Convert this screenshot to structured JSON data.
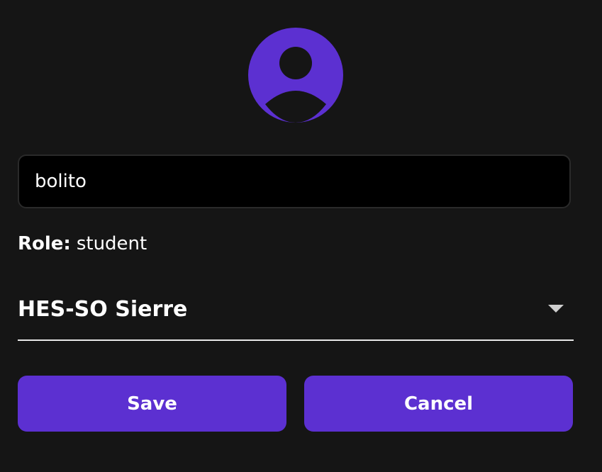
{
  "avatar": {
    "icon": "user-avatar-icon",
    "color": "#5c30d1"
  },
  "profile_form": {
    "username_value": "bolito",
    "role_label": "Role:",
    "role_value": "student",
    "school_select": {
      "selected": "HES-SO Sierre",
      "icon": "dropdown-arrow-icon"
    },
    "save_label": "Save",
    "cancel_label": "Cancel"
  },
  "colors": {
    "background": "#151515",
    "accent": "#5c30d1",
    "input_background": "#000000",
    "text": "#ffffff"
  }
}
